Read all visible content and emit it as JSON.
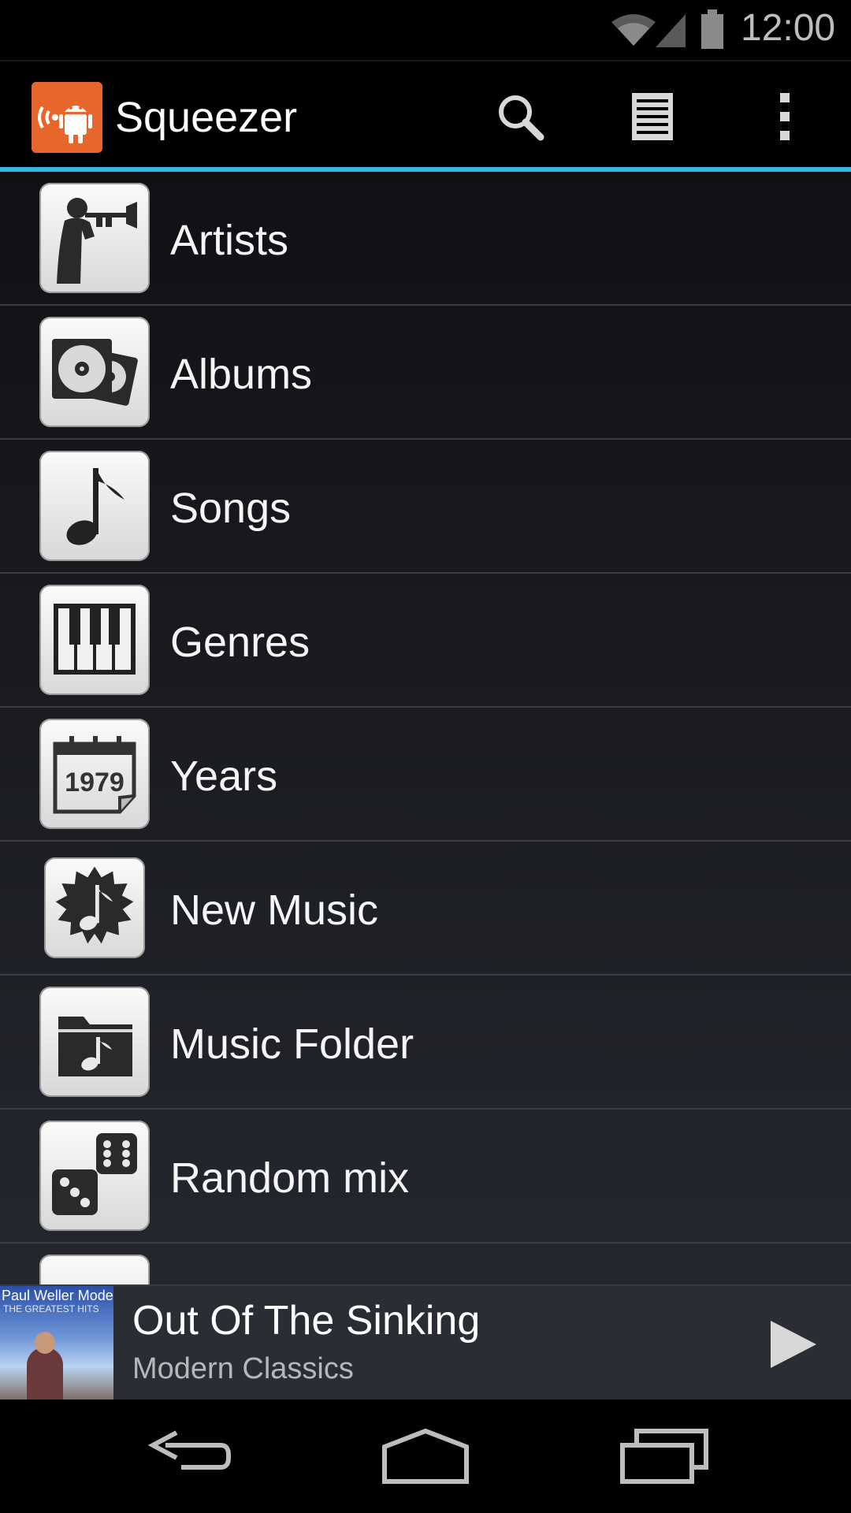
{
  "status_bar": {
    "time": "12:00",
    "icons": [
      "wifi-icon",
      "signal-icon",
      "battery-icon"
    ]
  },
  "action_bar": {
    "title": "Squeezer",
    "actions": [
      "search-icon",
      "playlist-icon",
      "overflow-menu-icon"
    ],
    "accent_color": "#33b5e5",
    "app_icon_color": "#e8662b"
  },
  "menu": {
    "items": [
      {
        "label": "Artists",
        "icon": "trumpet-player-icon"
      },
      {
        "label": "Albums",
        "icon": "albums-icon"
      },
      {
        "label": "Songs",
        "icon": "music-note-icon"
      },
      {
        "label": "Genres",
        "icon": "piano-keys-icon"
      },
      {
        "label": "Years",
        "icon": "calendar-year-icon"
      },
      {
        "label": "New Music",
        "icon": "new-music-badge-icon"
      },
      {
        "label": "Music Folder",
        "icon": "music-folder-icon"
      },
      {
        "label": "Random mix",
        "icon": "dice-icon"
      }
    ]
  },
  "now_playing": {
    "title": "Out Of The Sinking",
    "album": "Modern Classics",
    "art_artist": "Paul Weller",
    "art_title": "Modern Classics",
    "art_subtitle": "THE GREATEST HITS",
    "control": "play-icon"
  },
  "nav_bar": {
    "buttons": [
      "back-icon",
      "home-icon",
      "recent-apps-icon"
    ]
  }
}
